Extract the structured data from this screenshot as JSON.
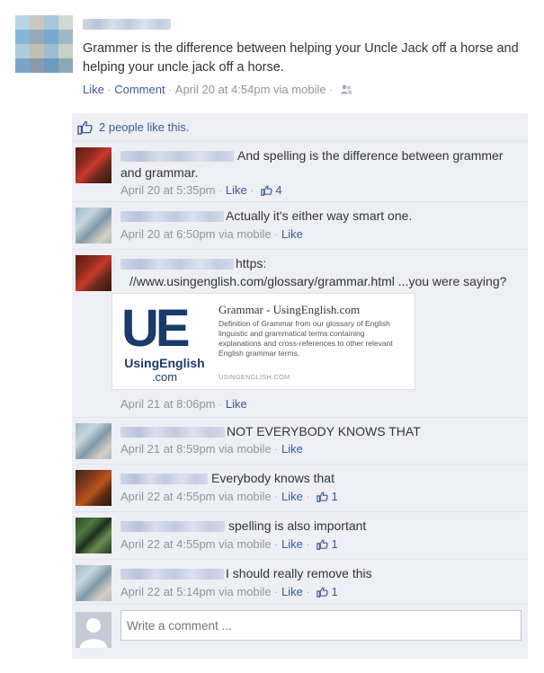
{
  "post": {
    "text": "Grammer is the difference between helping your Uncle Jack off a horse and helping your uncle jack off a horse.",
    "actions": {
      "like": "Like",
      "comment": "Comment",
      "timestamp": "April 20 at 4:54pm",
      "via": "via mobile"
    },
    "likes_summary": "2 people like this."
  },
  "comments": [
    {
      "text": "And spelling is the difference between grammer and grammar.",
      "timestamp": "April 20 at 5:35pm",
      "via": "",
      "like_label": "Like",
      "like_count": "4"
    },
    {
      "text": "Actually it's either way smart one.",
      "timestamp": "April 20 at 6:50pm",
      "via": "via mobile",
      "like_label": "Like",
      "like_count": ""
    },
    {
      "text_prefix": "https:",
      "text_link": "//www.usingenglish.com/glossary/grammar.html",
      "text_suffix": " ...you were saying?",
      "timestamp": "April 21 at 8:06pm",
      "via": "",
      "like_label": "Like",
      "like_count": "",
      "preview": {
        "logo_letters": "UE",
        "logo_name": "UsingEnglish",
        "logo_tld": ".com",
        "title": "Grammar - UsingEnglish.com",
        "description": "Definition of Grammar from our glossary of English linguistic and grammatical terms containing explanations and cross-references to other relevant English grammar terms.",
        "domain": "USINGENGLISH.COM"
      }
    },
    {
      "text": "NOT EVERYBODY KNOWS THAT",
      "timestamp": "April 21 at 8:59pm",
      "via": "via mobile",
      "like_label": "Like",
      "like_count": ""
    },
    {
      "text": "Everybody knows that",
      "timestamp": "April 22 at 4:55pm",
      "via": "via mobile",
      "like_label": "Like",
      "like_count": "1"
    },
    {
      "text": "spelling is also important",
      "timestamp": "April 22 at 4:55pm",
      "via": "via mobile",
      "like_label": "Like",
      "like_count": "1"
    },
    {
      "text": "I should really remove this",
      "timestamp": "April 22 at 5:14pm",
      "via": "via mobile",
      "like_label": "Like",
      "like_count": "1"
    }
  ],
  "composer": {
    "placeholder": "Write a comment ..."
  },
  "colors": {
    "link": "#3b5998",
    "meta": "#90949c",
    "feed_bg": "#edeff4"
  }
}
